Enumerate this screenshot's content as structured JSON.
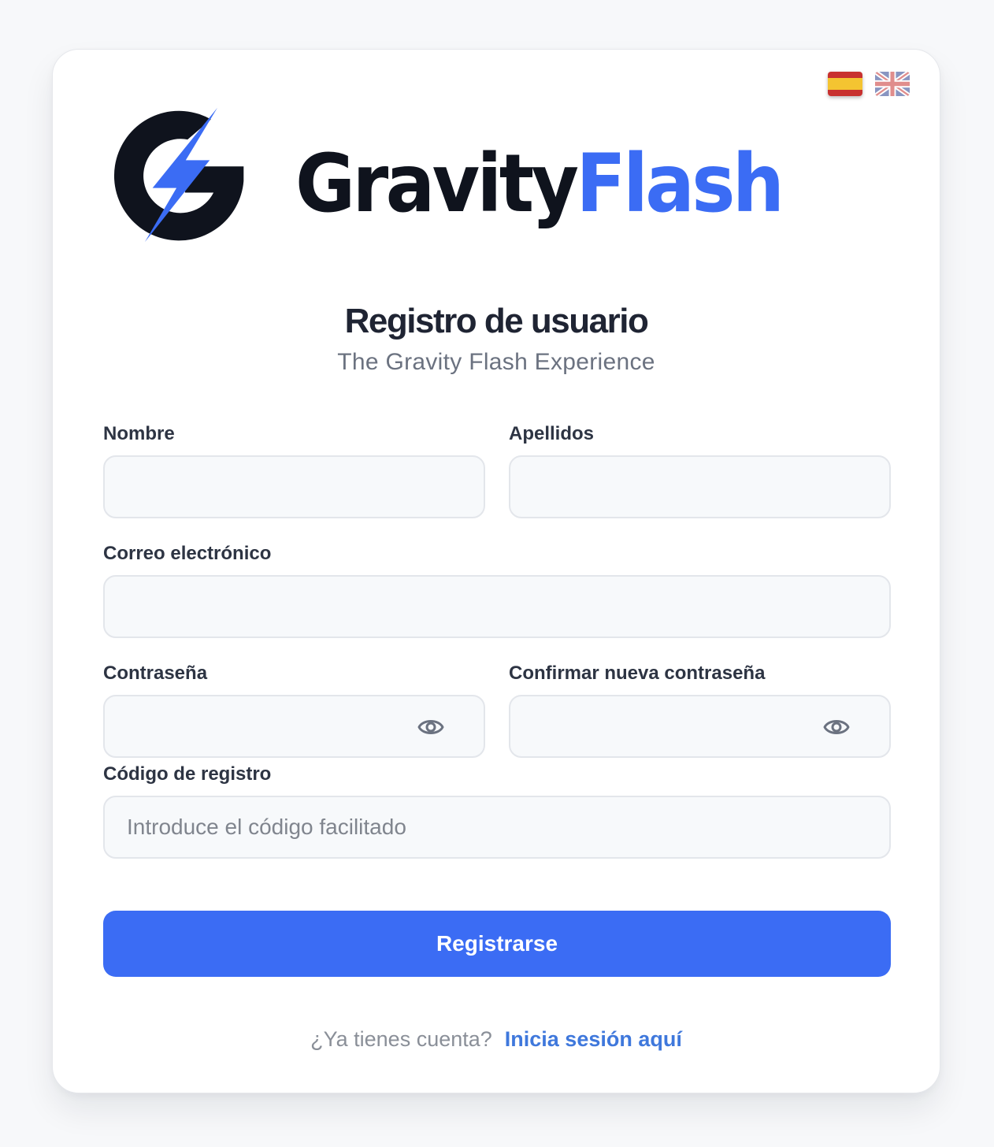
{
  "brand": {
    "name_part1": "Gravity",
    "name_part2": "Flash",
    "dark_color": "#0f131d",
    "accent_color": "#3b6cf4"
  },
  "languages": [
    {
      "code": "es",
      "icon": "spain-flag-icon",
      "active": true
    },
    {
      "code": "en",
      "icon": "uk-flag-icon",
      "active": false
    }
  ],
  "header": {
    "title": "Registro de usuario",
    "subtitle": "The Gravity Flash Experience"
  },
  "form": {
    "first_name": {
      "label": "Nombre",
      "value": "",
      "placeholder": ""
    },
    "last_name": {
      "label": "Apellidos",
      "value": "",
      "placeholder": ""
    },
    "email": {
      "label": "Correo electrónico",
      "value": "",
      "placeholder": ""
    },
    "password": {
      "label": "Contraseña",
      "value": "",
      "placeholder": "",
      "toggle_icon": "eye-icon"
    },
    "confirm_password": {
      "label": "Confirmar nueva contraseña",
      "value": "",
      "placeholder": "",
      "toggle_icon": "eye-icon"
    },
    "registration_code": {
      "label": "Código de registro",
      "value": "",
      "placeholder": "Introduce el código facilitado"
    },
    "submit_label": "Registrarse"
  },
  "footer": {
    "question": "¿Ya tienes cuenta?",
    "link_label": "Inicia sesión aquí"
  }
}
